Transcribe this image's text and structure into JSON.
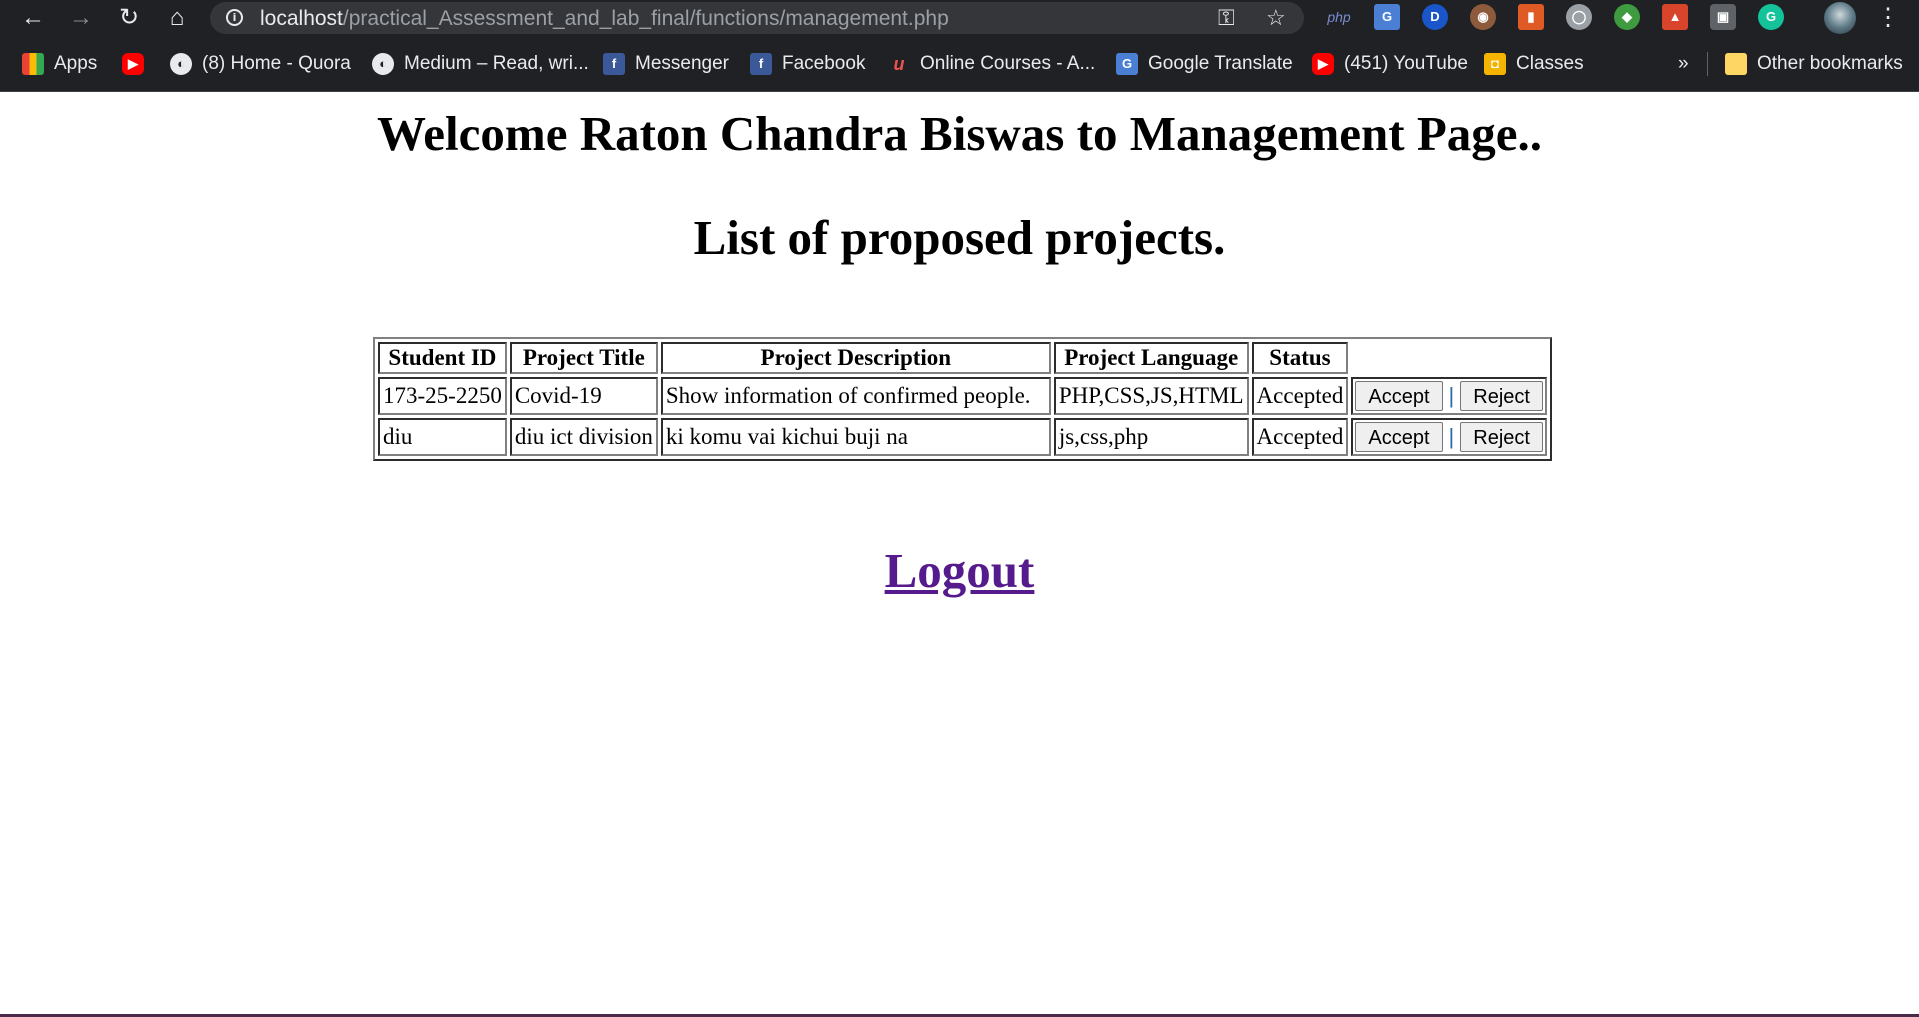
{
  "browser": {
    "url_host": "localhost",
    "url_path": "/practical_Assessment_and_lab_final/functions/management.php",
    "bookmarks": [
      {
        "label": "Apps",
        "icon": "apps-grid-icon"
      },
      {
        "label": "",
        "icon": "youtube-icon"
      },
      {
        "label": "(8) Home - Quora",
        "icon": "globe-icon"
      },
      {
        "label": "Medium – Read, wri...",
        "icon": "globe-icon"
      },
      {
        "label": "Messenger",
        "icon": "facebook-icon"
      },
      {
        "label": "Facebook",
        "icon": "facebook-icon"
      },
      {
        "label": "Online Courses - A...",
        "icon": "udemy-icon"
      },
      {
        "label": "Google Translate",
        "icon": "google-translate-icon"
      },
      {
        "label": "(451) YouTube",
        "icon": "youtube-icon"
      },
      {
        "label": "Classes",
        "icon": "classroom-icon"
      }
    ],
    "overflow_label": "»",
    "other_bookmarks": "Other bookmarks",
    "ext_php_label": "php"
  },
  "page": {
    "welcome_heading": "Welcome Raton Chandra Biswas to Management Page..",
    "list_heading": "List of proposed projects.",
    "table": {
      "headers": [
        "Student ID",
        "Project Title",
        "Project Description",
        "Project Language",
        "Status"
      ],
      "rows": [
        {
          "student_id": "173-25-2250",
          "title": "Covid-19",
          "description": "Show information of confirmed people.",
          "language": "PHP,CSS,JS,HTML",
          "status": "Accepted"
        },
        {
          "student_id": "diu",
          "title": "diu ict division",
          "description": "ki komu vai kichui buji na",
          "language": "js,css,php",
          "status": "Accepted"
        }
      ],
      "accept_label": "Accept",
      "reject_label": "Reject",
      "separator": "|"
    },
    "logout_label": "Logout"
  }
}
